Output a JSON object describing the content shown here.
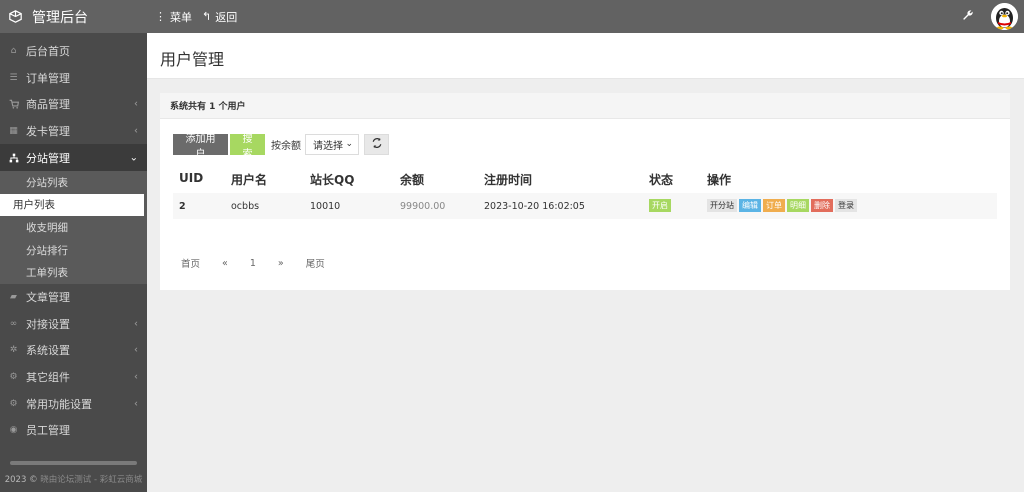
{
  "header": {
    "brand": "管理后台",
    "menu_label": "菜单",
    "back_label": "返回"
  },
  "sidebar": {
    "items": [
      {
        "label": "后台首页",
        "icon": "home-icon"
      },
      {
        "label": "订单管理",
        "icon": "list-icon"
      },
      {
        "label": "商品管理",
        "icon": "cart-icon"
      },
      {
        "label": "发卡管理",
        "icon": "grid-icon"
      },
      {
        "label": "分站管理",
        "icon": "sitemap-icon"
      },
      {
        "label": "文章管理",
        "icon": "book-icon"
      },
      {
        "label": "对接设置",
        "icon": "link-icon"
      },
      {
        "label": "系统设置",
        "icon": "gear-icon"
      },
      {
        "label": "其它组件",
        "icon": "cogs-icon"
      },
      {
        "label": "常用功能设置",
        "icon": "cogs-icon"
      },
      {
        "label": "员工管理",
        "icon": "user-icon"
      }
    ],
    "sub_items": [
      "分站列表",
      "用户列表",
      "收支明细",
      "分站排行",
      "工单列表"
    ],
    "footer_year": "2023",
    "footer_link": "彩虹云商城",
    "footer_gray": "晓由论坛测试 - "
  },
  "page": {
    "title": "用户管理"
  },
  "panel": {
    "heading": "系统共有 1 个用户",
    "add_button": "添加用户",
    "search_button": "搜索",
    "sort_label": "按余额",
    "select_value": "请选择"
  },
  "table": {
    "columns": [
      "UID",
      "用户名",
      "站长QQ",
      "余额",
      "注册时间",
      "状态",
      "操作"
    ],
    "rows": [
      {
        "uid": "2",
        "username": "ocbbs",
        "qq": "10010",
        "balance": "99900.00",
        "reg_time": "2023-10-20 16:02:05",
        "status": "开启",
        "actions": [
          "开分站",
          "编辑",
          "订单",
          "明细",
          "删除",
          "登录"
        ]
      }
    ]
  },
  "pagination": {
    "first": "首页",
    "prev": "«",
    "page": "1",
    "next": "»",
    "last": "尾页"
  },
  "colors": {
    "topbar": "#626262",
    "sidebar": "#4a4a4a",
    "green": "#a7d861",
    "blue": "#5bb4e5",
    "orange": "#f0ad4e",
    "red": "#e26d5c"
  }
}
